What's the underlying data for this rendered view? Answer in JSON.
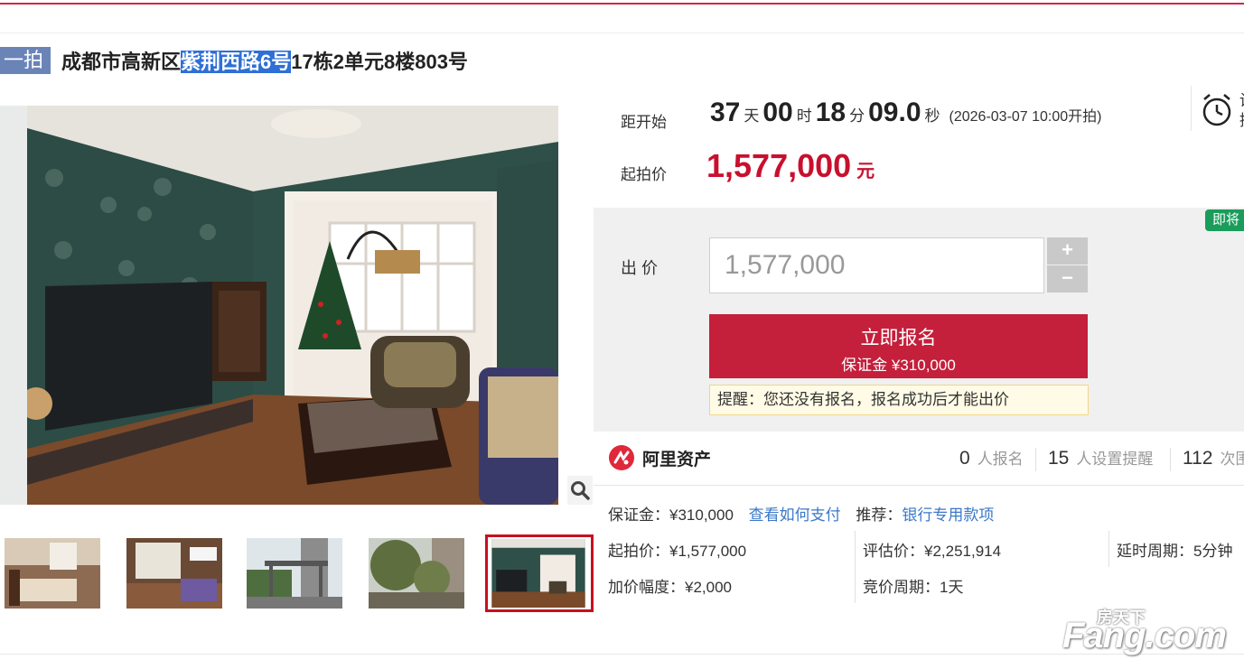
{
  "header": {
    "badge": "一拍",
    "title_prefix": "成都市高新区",
    "title_highlight": "紫荆西路6号",
    "title_suffix": "17栋2单元8楼803号"
  },
  "countdown": {
    "label": "距开始",
    "days": "37",
    "days_unit": "天",
    "hours": "00",
    "hours_unit": "时",
    "minutes": "18",
    "minutes_unit": "分",
    "seconds": "09.0",
    "seconds_unit": "秒",
    "start_text": "(2026-03-07 10:00开拍)"
  },
  "starting_price": {
    "label": "起拍价",
    "value": "1,577,000",
    "unit": "元"
  },
  "alarm": {
    "icon": "alarm-clock-icon",
    "label_line1": "设",
    "label_line2": "提"
  },
  "bid": {
    "label": "出 价",
    "value": "1,577,000",
    "plus": "+",
    "minus": "−",
    "soon_tag": "即将"
  },
  "signup": {
    "title": "立即报名",
    "deposit": "保证金 ¥310,000"
  },
  "tip": "提醒：您还没有报名，报名成功后才能出价",
  "platform": {
    "name": "阿里资产",
    "stats": [
      {
        "num": "0",
        "unit": "人报名"
      },
      {
        "num": "15",
        "unit": "人设置提醒"
      },
      {
        "num": "112",
        "unit": "次围观"
      }
    ]
  },
  "details": {
    "deposit": "保证金：¥310,000",
    "how_to_pay": "查看如何支付",
    "recommend_label": "推荐：",
    "recommend_link": "银行专用款项",
    "start_price": "起拍价：¥1,577,000",
    "appraisal": "评估价：¥2,251,914",
    "extension": "延时周期：5分钟",
    "increment": "加价幅度：¥2,000",
    "cycle": "竞价周期：1天"
  },
  "watermark": {
    "top": "房天下",
    "bottom": "Fang.com"
  },
  "colors": {
    "accent": "#c41f3b",
    "price": "#c8102e",
    "link": "#3a78c9",
    "tag_green": "#1a9c5a",
    "badge": "#6a84b8"
  }
}
